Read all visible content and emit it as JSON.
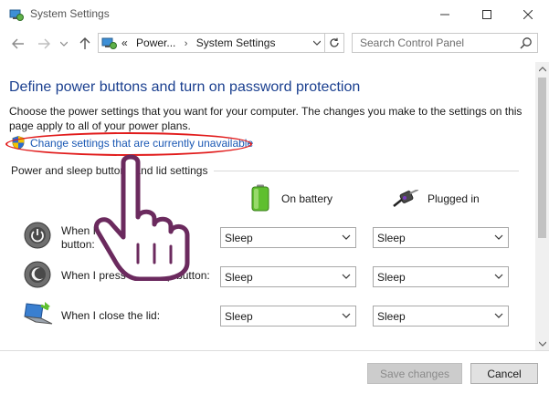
{
  "window": {
    "title": "System Settings",
    "buttons": {
      "minimize": "minimize",
      "maximize": "maximize",
      "close": "close"
    }
  },
  "navigation": {
    "breadcrumbs": [
      "Power...",
      "System Settings"
    ],
    "breadcrumb_prefix": "«",
    "search_placeholder": "Search Control Panel"
  },
  "main": {
    "heading": "Define power buttons and turn on password protection",
    "description": "Choose the power settings that you want for your computer. The changes you make to the settings on this page apply to all of your power plans.",
    "change_link": "Change settings that are currently unavailable",
    "section_title": "Power and sleep buttons and lid settings",
    "columns": {
      "on_battery": "On battery",
      "plugged_in": "Plugged in"
    },
    "rows": [
      {
        "label": "When I press the power button:",
        "icon": "power-button-icon",
        "on_battery": "Sleep",
        "plugged_in": "Sleep"
      },
      {
        "label": "When I press the sleep button:",
        "icon": "sleep-button-icon",
        "on_battery": "Sleep",
        "plugged_in": "Sleep"
      },
      {
        "label": "When I close the lid:",
        "icon": "laptop-lid-icon",
        "on_battery": "Sleep",
        "plugged_in": "Sleep"
      }
    ]
  },
  "footer": {
    "save_label": "Save changes",
    "cancel_label": "Cancel"
  },
  "colors": {
    "heading": "#1a3f8f",
    "link": "#1a58b4",
    "highlight_ellipse": "#e11b1b",
    "hand_outline": "#6b2a5e"
  }
}
